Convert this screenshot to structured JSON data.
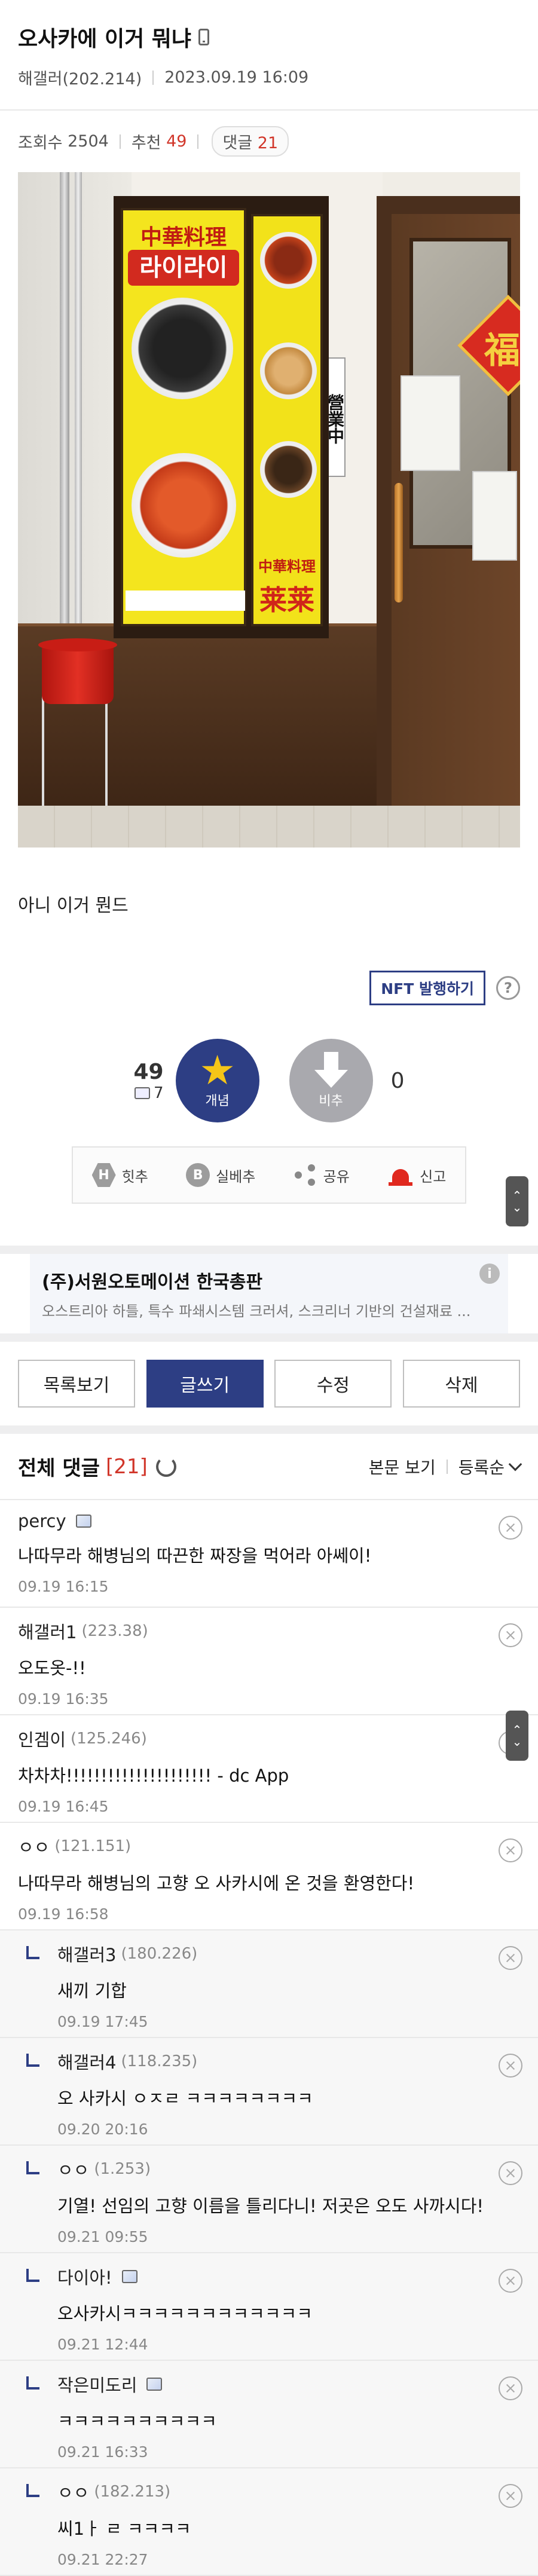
{
  "post": {
    "title": "오사카에 이거 뭐냐",
    "author": "해갤러(202.214)",
    "date": "2023.09.19 16:09",
    "views_label": "조회수",
    "views": "2504",
    "recommend_label": "추천",
    "recommend": "49",
    "comments_label": "댓글",
    "comments": "21",
    "body": "아니 이거 뭔드"
  },
  "photo": {
    "sign_top": "中華料理",
    "sign_name": "라이라이",
    "sign_bottom_small": "中華料理",
    "sign_bottom_big": "莱莱",
    "door_sign": "營業中",
    "fuku": "福"
  },
  "nft": {
    "button": "NFT 발행하기",
    "help": "?"
  },
  "votes": {
    "up_count": "49",
    "fixed_count": "7",
    "up_label": "개념",
    "down_label": "비추",
    "down_count": "0"
  },
  "actions": [
    {
      "icon": "H",
      "label": "힛추"
    },
    {
      "icon": "B",
      "label": "실베추"
    },
    {
      "icon": "",
      "label": "공유"
    },
    {
      "icon": "",
      "label": "신고"
    }
  ],
  "ad": {
    "title": "(주)서원오토메이션 한국총판",
    "desc": "오스트리아 하틀, 특수 파쇄시스템 크러셔, 스크리너 기반의 건설재료 ...",
    "info": "i"
  },
  "buttons": {
    "list": "목록보기",
    "write": "글쓰기",
    "edit": "수정",
    "delete": "삭제"
  },
  "comment_header": {
    "title": "전체 댓글",
    "count": "[21]",
    "view_body": "본문 보기",
    "sort": "등록순"
  },
  "scroll": {
    "up": "⌃",
    "down": "⌄"
  },
  "comments": [
    {
      "nick": "percy",
      "ip": "",
      "fixed": true,
      "text": "나따무라 해병님의 따끈한 짜장을 먹어라 아쎄이!",
      "date": "09.19 16:15",
      "reply": false
    },
    {
      "nick": "해갤러1",
      "ip": "(223.38)",
      "fixed": false,
      "text": "오도옷-!!",
      "date": "09.19 16:35",
      "reply": false
    },
    {
      "nick": "인겜이",
      "ip": "(125.246)",
      "fixed": false,
      "text": "차차차!!!!!!!!!!!!!!!!!!!!! - dc App",
      "date": "09.19 16:45",
      "reply": false
    },
    {
      "nick": "ㅇㅇ",
      "ip": "(121.151)",
      "fixed": false,
      "text": "나따무라 해병님의 고향 오 사카시에 온 것을 환영한다!",
      "date": "09.19 16:58",
      "reply": false
    },
    {
      "nick": "해갤러3",
      "ip": "(180.226)",
      "fixed": false,
      "text": "새끼 기합",
      "date": "09.19 17:45",
      "reply": true
    },
    {
      "nick": "해갤러4",
      "ip": "(118.235)",
      "fixed": false,
      "text": "오 사카시 ㅇㅈㄹ ㅋㅋㅋㅋㅋㅋㅋㅋ",
      "date": "09.20 20:16",
      "reply": true
    },
    {
      "nick": "ㅇㅇ",
      "ip": "(1.253)",
      "fixed": false,
      "text": "기열! 선임의 고향 이름을 틀리다니! 저곳은 오도 사까시다!",
      "date": "09.21 09:55",
      "reply": true
    },
    {
      "nick": "다이아!",
      "ip": "",
      "fixed": true,
      "text": "오사카시ㅋㅋㅋㅋㅋㅋㅋㅋㅋㅋㅋㅋ",
      "date": "09.21 12:44",
      "reply": true
    },
    {
      "nick": "작은미도리",
      "ip": "",
      "fixed": true,
      "text": "ㅋㅋㅋㅋㅋㅋㅋㅋㅋㅋ",
      "date": "09.21 16:33",
      "reply": true
    },
    {
      "nick": "ㅇㅇ",
      "ip": "(182.213)",
      "fixed": false,
      "text": "씨1ㅏ ㄹ ㅋㅋㅋㅋ",
      "date": "09.21 22:27",
      "reply": true
    }
  ]
}
